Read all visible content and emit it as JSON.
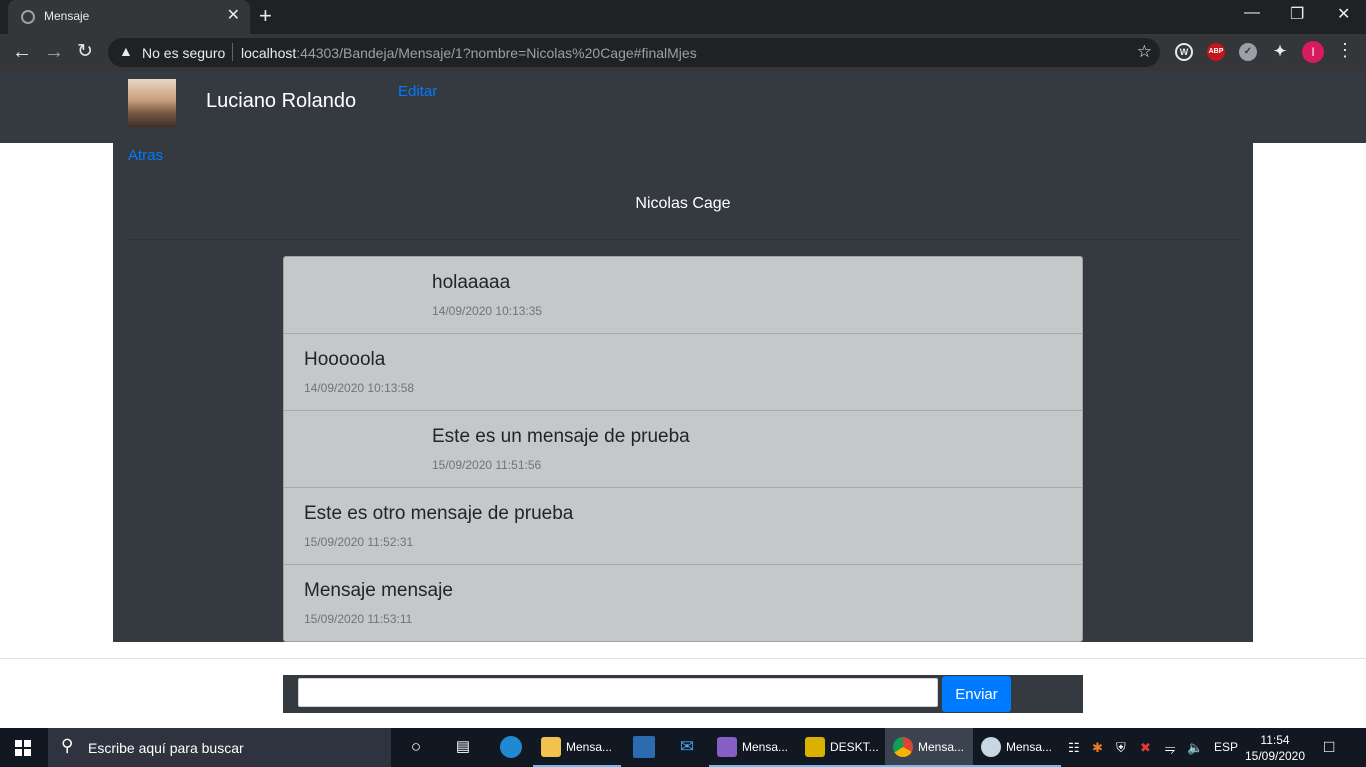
{
  "browser": {
    "tab_title": "Mensaje",
    "tab_close": "✕",
    "new_tab": "+",
    "security_label": "No es seguro",
    "url_host": "localhost",
    "url_rest": ":44303/Bandeja/Mensaje/1?nombre=Nicolas%20Cage#finalMjes",
    "ext_abp": "ABP",
    "profile_initial": "I"
  },
  "header": {
    "user_name": "Luciano Rolando",
    "edit_link": "Editar"
  },
  "chat": {
    "back_link": "Atras",
    "contact_name": "Nicolas Cage",
    "messages": [
      {
        "text": "holaaaaa",
        "time": "14/09/2020 10:13:35",
        "side": "sent"
      },
      {
        "text": "Hooooola",
        "time": "14/09/2020 10:13:58",
        "side": "received"
      },
      {
        "text": "Este es un mensaje de prueba",
        "time": "15/09/2020 11:51:56",
        "side": "sent"
      },
      {
        "text": "Este es otro mensaje de prueba",
        "time": "15/09/2020 11:52:31",
        "side": "received"
      },
      {
        "text": "Mensaje mensaje",
        "time": "15/09/2020 11:53:11",
        "side": "received"
      }
    ]
  },
  "composer": {
    "input_value": "",
    "send_label": "Enviar"
  },
  "taskbar": {
    "search_placeholder": "Escribe aquí para buscar",
    "apps": [
      {
        "label": "Mensa...",
        "icon": "folder-icon"
      },
      {
        "label": "Mensa...",
        "icon": "visual-studio-icon"
      },
      {
        "label": "DESKT...",
        "icon": "sql-server-icon"
      },
      {
        "label": "Mensa...",
        "icon": "chrome-icon"
      },
      {
        "label": "Mensa...",
        "icon": "paint-icon"
      }
    ],
    "language": "ESP",
    "time": "11:54",
    "date": "15/09/2020"
  }
}
